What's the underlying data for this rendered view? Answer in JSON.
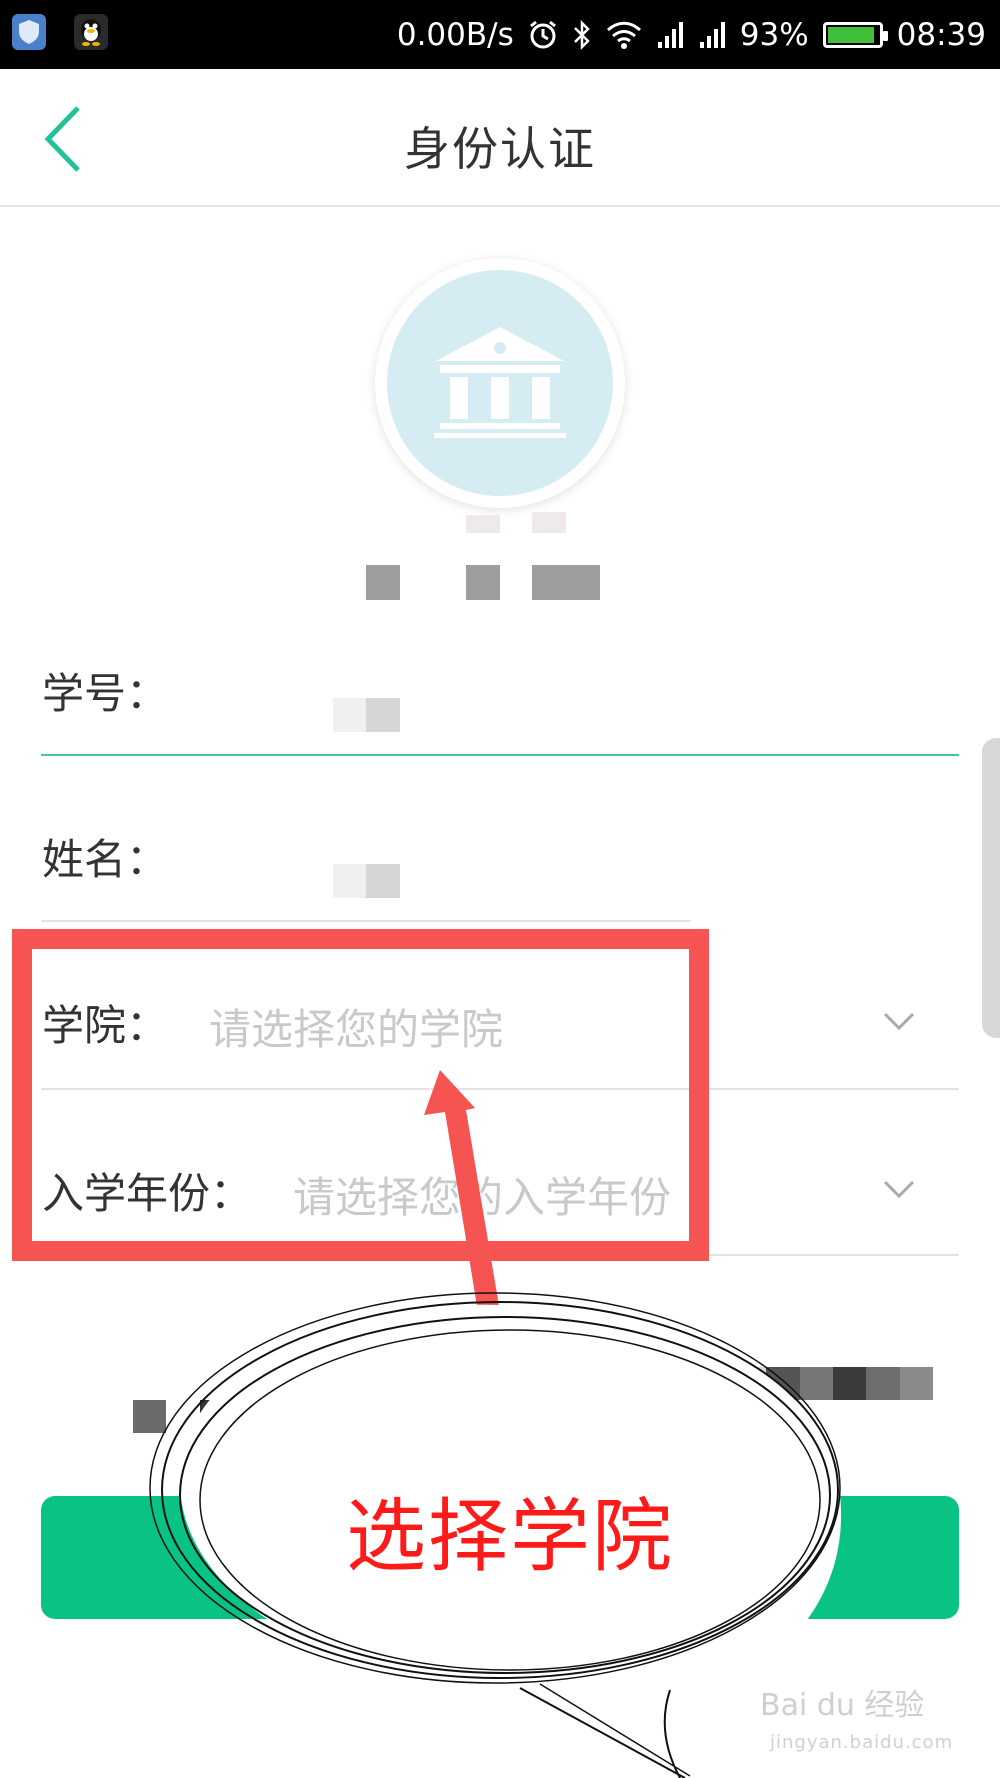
{
  "status_bar": {
    "net_speed": "0.00B/s",
    "battery_percent": "93%",
    "time": "08:39",
    "battery_level": 0.93,
    "icons": [
      "shield-app-icon",
      "qq-app-icon",
      "alarm-icon",
      "bluetooth-icon",
      "wifi-icon",
      "signal-icon",
      "signal-icon",
      "battery-icon"
    ]
  },
  "header": {
    "title": "身份认证",
    "back_icon": "chevron-left-icon"
  },
  "avatar": {
    "icon": "institution-building-icon"
  },
  "form": {
    "student_id_label": "学号：",
    "name_label": "姓名：",
    "college_label": "学院：",
    "college_placeholder": "请选择您的学院",
    "year_label": "入学年份：",
    "year_placeholder": "请选择您的入学年份"
  },
  "annotation": {
    "callout_text": "选择学院"
  },
  "watermark": {
    "brand": "Bai du 经验",
    "url": "jingyan.baidu.com"
  },
  "colors": {
    "accent_green": "#08c383",
    "annotation_red": "#f65353",
    "avatar_bg": "#d6ecf3"
  }
}
